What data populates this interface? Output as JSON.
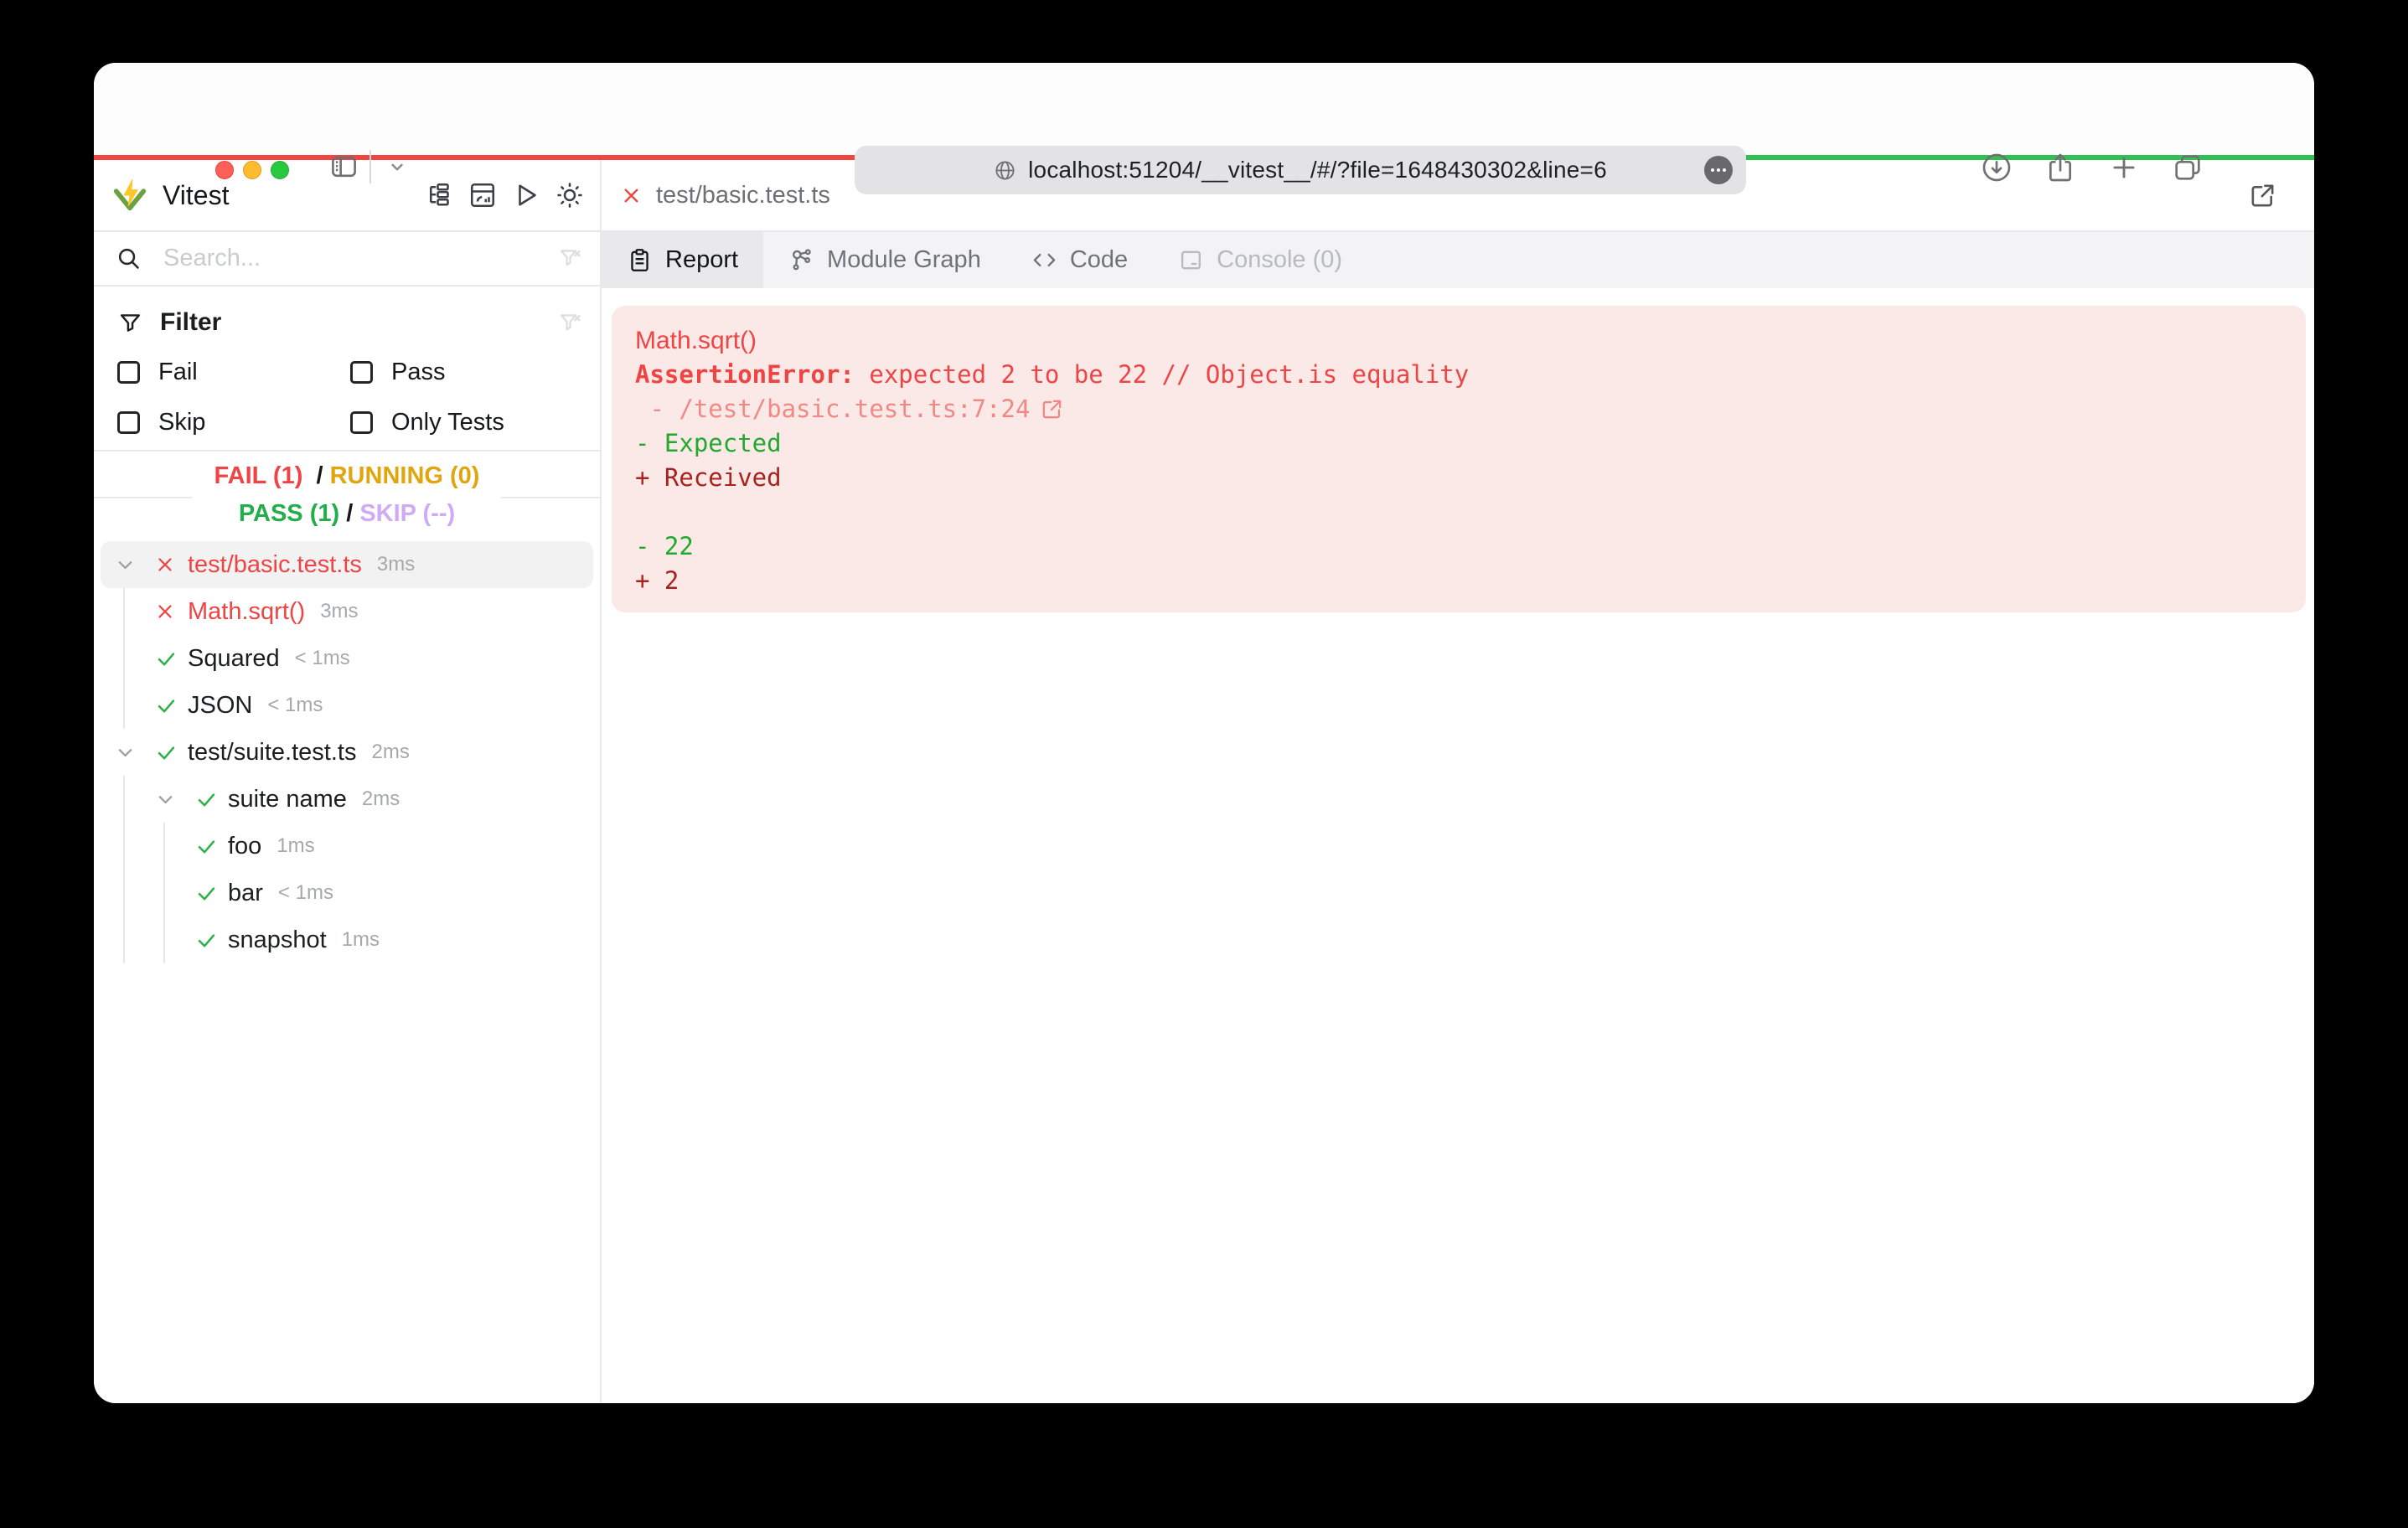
{
  "browser": {
    "url": "localhost:51204/__vitest__/#/?file=1648430302&line=6",
    "toolbar_icons": [
      "sidebar-toggle-icon",
      "chevron-down-icon",
      "globe-icon",
      "ellipsis-icon",
      "download-icon",
      "share-icon",
      "new-tab-icon",
      "tab-overview-icon"
    ]
  },
  "progress": {
    "fail_fraction": 0.5,
    "pass_fraction": 0.5,
    "fail_color": "#f0463f",
    "pass_color": "#30c152"
  },
  "sidebar": {
    "title": "Vitest",
    "toolbar_icons": [
      "tree-view-icon",
      "dashboard-icon",
      "run-all-icon",
      "theme-toggle-icon"
    ],
    "search": {
      "placeholder": "Search...",
      "value": ""
    },
    "filter": {
      "title": "Filter",
      "options": [
        {
          "label": "Fail",
          "checked": false
        },
        {
          "label": "Pass",
          "checked": false
        },
        {
          "label": "Skip",
          "checked": false
        },
        {
          "label": "Only Tests",
          "checked": false
        }
      ]
    },
    "summary": {
      "fail": "FAIL (1)",
      "running": "RUNNING (0)",
      "pass": "PASS (1)",
      "skip": "SKIP (--)",
      "separator": "/"
    },
    "tree": [
      {
        "depth": 0,
        "chevron": true,
        "status": "fail",
        "label": "test/basic.test.ts",
        "time": "3ms",
        "highlight": true
      },
      {
        "depth": 1,
        "chevron": false,
        "status": "fail",
        "label": "Math.sqrt()",
        "time": "3ms",
        "highlight": false
      },
      {
        "depth": 1,
        "chevron": false,
        "status": "pass",
        "label": "Squared",
        "time": "< 1ms",
        "highlight": false
      },
      {
        "depth": 1,
        "chevron": false,
        "status": "pass",
        "label": "JSON",
        "time": "< 1ms",
        "highlight": false
      },
      {
        "depth": 0,
        "chevron": true,
        "status": "pass",
        "label": "test/suite.test.ts",
        "time": "2ms",
        "highlight": false
      },
      {
        "depth": 1,
        "chevron": true,
        "status": "pass",
        "label": "suite name",
        "time": "2ms",
        "highlight": false
      },
      {
        "depth": 2,
        "chevron": false,
        "status": "pass",
        "label": "foo",
        "time": "1ms",
        "highlight": false
      },
      {
        "depth": 2,
        "chevron": false,
        "status": "pass",
        "label": "bar",
        "time": "< 1ms",
        "highlight": false
      },
      {
        "depth": 2,
        "chevron": false,
        "status": "pass",
        "label": "snapshot",
        "time": "1ms",
        "highlight": false
      }
    ]
  },
  "main": {
    "file_tab": {
      "label": "test/basic.test.ts"
    },
    "tabs": [
      {
        "label": "Report",
        "icon": "report-icon",
        "state": "active"
      },
      {
        "label": "Module Graph",
        "icon": "module-graph-icon",
        "state": "normal"
      },
      {
        "label": "Code",
        "icon": "code-icon",
        "state": "normal"
      },
      {
        "label": "Console (0)",
        "icon": "console-icon",
        "state": "disabled"
      }
    ],
    "report": {
      "lines": [
        {
          "segments": [
            {
              "text": "Math.sqrt()",
              "tone": "t-test"
            }
          ]
        },
        {
          "segments": [
            {
              "text": "AssertionError: ",
              "tone": "t-errb"
            },
            {
              "text": "expected 2 to be 22 // Object.is equality",
              "tone": "t-err"
            }
          ]
        },
        {
          "segments": [
            {
              "text": " - /test/basic.test.ts:7:24",
              "tone": "t-path"
            }
          ],
          "link": true
        },
        {
          "segments": [
            {
              "text": "- Expected",
              "tone": "t-green"
            }
          ]
        },
        {
          "segments": [
            {
              "text": "+ Received",
              "tone": "t-dred"
            }
          ]
        },
        {
          "segments": []
        },
        {
          "segments": [
            {
              "text": "- 22",
              "tone": "t-green"
            }
          ]
        },
        {
          "segments": [
            {
              "text": "+ 2",
              "tone": "t-dred"
            }
          ]
        }
      ]
    }
  }
}
